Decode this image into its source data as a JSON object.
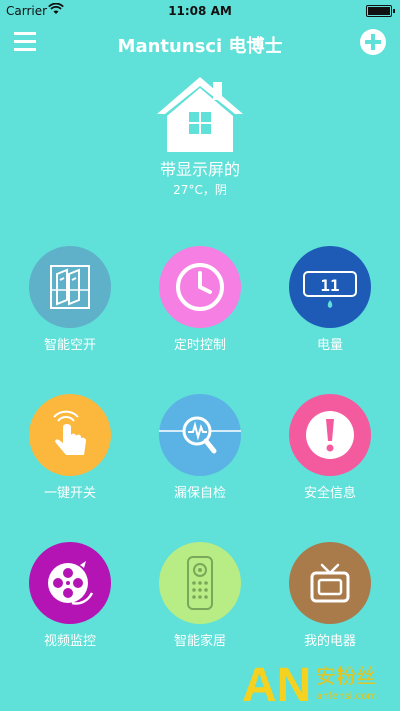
{
  "status": {
    "carrier": "Carrier",
    "time": "11:08 AM"
  },
  "nav": {
    "title": "Mantunsci 电博士"
  },
  "device": {
    "name": "带显示屏的",
    "weather": "27°C，阴"
  },
  "features": [
    {
      "label": "智能空开",
      "icon": "breaker-switch-icon",
      "color": "#5fb0c9"
    },
    {
      "label": "定时控制",
      "icon": "clock-icon",
      "color": "#f57fe2"
    },
    {
      "label": "电量",
      "icon": "power-meter-icon",
      "color": "#1e5bb7"
    },
    {
      "label": "一键开关",
      "icon": "tap-finger-icon",
      "color": "#fbb83c"
    },
    {
      "label": "漏保自检",
      "icon": "magnifier-wave-icon",
      "color": "#5bb2e4"
    },
    {
      "label": "安全信息",
      "icon": "alert-icon",
      "color": "#f45a9e"
    },
    {
      "label": "视频监控",
      "icon": "film-reel-icon",
      "color": "#b414b4"
    },
    {
      "label": "智能家居",
      "icon": "remote-control-icon",
      "color": "#b8ec84"
    },
    {
      "label": "我的电器",
      "icon": "tv-icon",
      "color": "#a97a4a"
    }
  ],
  "meter_display": "11",
  "watermark": {
    "logo": "AN",
    "text": "安粉丝",
    "url": "anfensi.com"
  }
}
